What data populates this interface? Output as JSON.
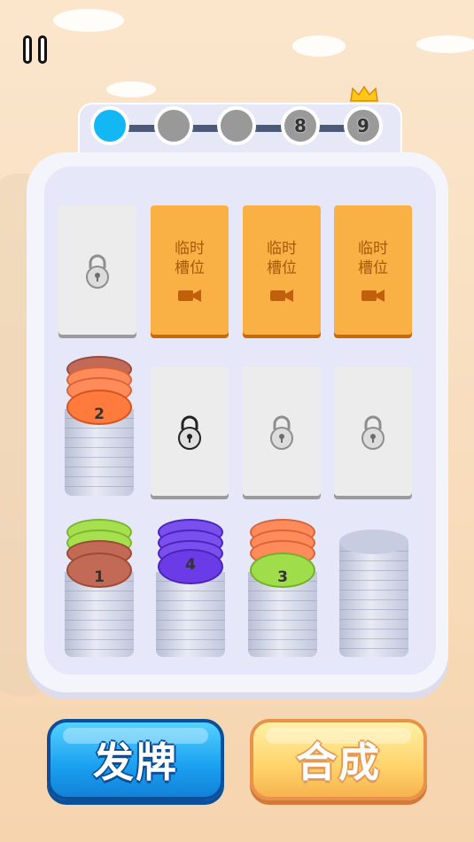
{
  "hud": {
    "pause_icon": "pause-icon"
  },
  "progress": {
    "nodes": [
      {
        "label": "",
        "state": "active"
      },
      {
        "label": "",
        "state": "done"
      },
      {
        "label": "",
        "state": "done"
      },
      {
        "label": "8",
        "state": "upcoming"
      },
      {
        "label": "9",
        "state": "boss"
      }
    ]
  },
  "slots": {
    "temp_label_line1": "临时",
    "temp_label_line2": "槽位",
    "temp_icon": "video-camera-icon",
    "lock_icon": "padlock-icon"
  },
  "stacks": [
    {
      "label": "2",
      "top_color": "#ff7a3d",
      "chips": [
        "#c26a55",
        "#ff8a5a",
        "#ff8a5a",
        "#ff7a3d"
      ]
    },
    {
      "label": "1",
      "top_color": "#c26a55",
      "chips": [
        "#9fdd4a",
        "#9fdd4a",
        "#c26a55",
        "#c26a55"
      ]
    },
    {
      "label": "4",
      "top_color": "#6a3be6",
      "chips": [
        "#6a3be6",
        "#6a3be6",
        "#6a3be6",
        "#6a3be6"
      ]
    },
    {
      "label": "3",
      "top_color": "#9fdd4a",
      "chips": [
        "#ff8a5a",
        "#ff8a5a",
        "#ff8a5a",
        "#9fdd4a"
      ]
    }
  ],
  "buttons": {
    "deal": "发牌",
    "merge": "合成"
  }
}
